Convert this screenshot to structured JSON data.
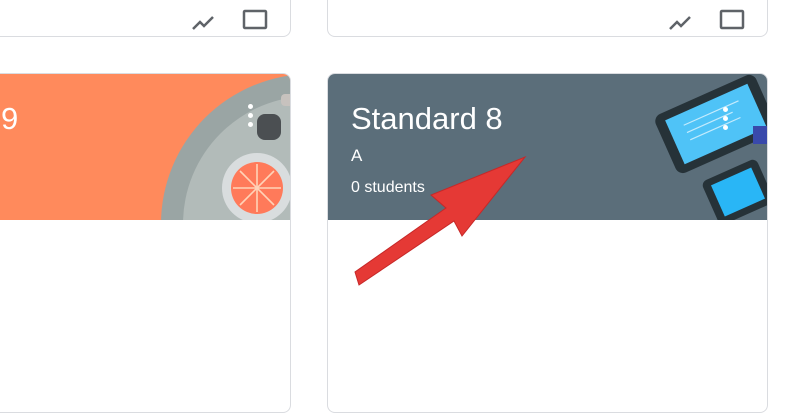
{
  "classes": [
    {
      "title": "9",
      "section": "",
      "students": "",
      "banner_color": "#ff8a5c"
    },
    {
      "title": "Standard 8",
      "section": "A",
      "students": "0 students",
      "banner_color": "#5b6e7a"
    }
  ],
  "icons": {
    "card_menu": "more-vert-icon",
    "folder": "folder-icon",
    "trending": "trending-icon",
    "callout": "red-arrow-annotation"
  }
}
